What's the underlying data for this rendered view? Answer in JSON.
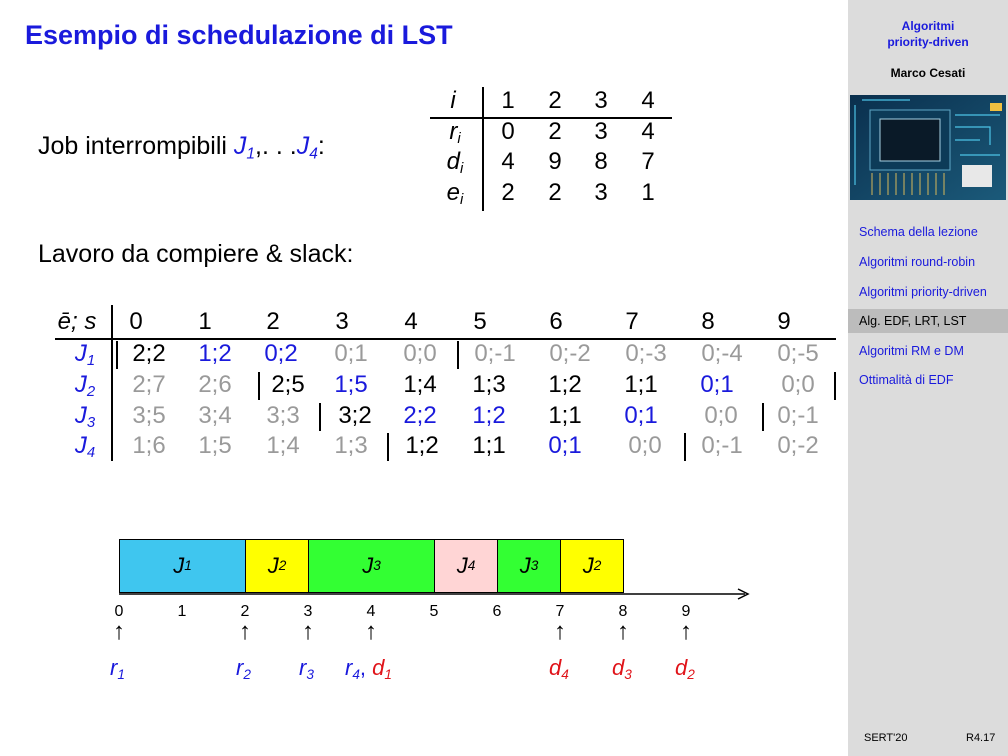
{
  "slide": {
    "title": "Esempio di schedulazione di LST",
    "jobs_label": "Job interrompibili",
    "jobs_range": ",. . .",
    "work_label": "Lavoro da compiere & slack:"
  },
  "params_table": {
    "header": [
      "i",
      "1",
      "2",
      "3",
      "4"
    ],
    "rows": [
      {
        "label": "r",
        "sub": "i",
        "values": [
          "0",
          "2",
          "3",
          "4"
        ]
      },
      {
        "label": "d",
        "sub": "i",
        "values": [
          "4",
          "9",
          "8",
          "7"
        ]
      },
      {
        "label": "e",
        "sub": "i",
        "values": [
          "2",
          "2",
          "3",
          "1"
        ]
      }
    ]
  },
  "slack_table": {
    "corner": "ē; s",
    "times": [
      "0",
      "1",
      "2",
      "3",
      "4",
      "5",
      "6",
      "7",
      "8",
      "9"
    ],
    "rows": [
      {
        "job": "J",
        "sub": "1",
        "cells": [
          "2;2",
          "1;2",
          "0;2",
          "0;1",
          "0;0",
          "0;-1",
          "0;-2",
          "0;-3",
          "0;-4",
          "0;-5"
        ]
      },
      {
        "job": "J",
        "sub": "2",
        "cells": [
          "2;7",
          "2;6",
          "2;5",
          "1;5",
          "1;4",
          "1;3",
          "1;2",
          "1;1",
          "0;1",
          "0;0"
        ]
      },
      {
        "job": "J",
        "sub": "3",
        "cells": [
          "3;5",
          "3;4",
          "3;3",
          "3;2",
          "2;2",
          "1;2",
          "1;1",
          "0;1",
          "0;0",
          "0;-1"
        ]
      },
      {
        "job": "J",
        "sub": "4",
        "cells": [
          "1;6",
          "1;5",
          "1;4",
          "1;3",
          "1;2",
          "1;1",
          "0;1",
          "0;0",
          "0;-1",
          "0;-2"
        ]
      }
    ]
  },
  "gantt": {
    "blocks": [
      {
        "job": "J",
        "sub": "1",
        "color": "#3fc6ef"
      },
      {
        "job": "J",
        "sub": "2",
        "color": "#ffff00"
      },
      {
        "job": "J",
        "sub": "3",
        "color": "#33ff33"
      },
      {
        "job": "J",
        "sub": "4",
        "color": "#ffd5d5"
      },
      {
        "job": "J",
        "sub": "3",
        "color": "#33ff33"
      },
      {
        "job": "J",
        "sub": "2",
        "color": "#ffff00"
      }
    ],
    "ticks": [
      "0",
      "1",
      "2",
      "3",
      "4",
      "5",
      "6",
      "7",
      "8",
      "9"
    ],
    "markers": [
      {
        "text": "r",
        "sub": "1"
      },
      {
        "text": "r",
        "sub": "2"
      },
      {
        "text": "r",
        "sub": "3"
      },
      {
        "text": "r",
        "sub": "4"
      },
      {
        "text": "d",
        "sub": "1"
      },
      {
        "text": "d",
        "sub": "4"
      },
      {
        "text": "d",
        "sub": "3"
      },
      {
        "text": "d",
        "sub": "2"
      }
    ]
  },
  "sidebar": {
    "title_line1": "Algoritmi",
    "title_line2": "priority-driven",
    "author": "Marco Cesati",
    "items": [
      {
        "label": "Schema della lezione"
      },
      {
        "label": "Algoritmi round-robin"
      },
      {
        "label": "Algoritmi priority-driven"
      },
      {
        "label": "Alg. EDF, LRT, LST",
        "active": true
      },
      {
        "label": "Algoritmi RM e DM"
      },
      {
        "label": "Ottimalità di EDF"
      }
    ],
    "footer_left": "SERT'20",
    "footer_right": "R4.17"
  },
  "colors": {
    "title": "#1a1adc",
    "link": "#1a1adc",
    "deadline": "#e0141a",
    "grayed": "#9a9a9a",
    "sidebar_bg": "#dcdcdc"
  }
}
